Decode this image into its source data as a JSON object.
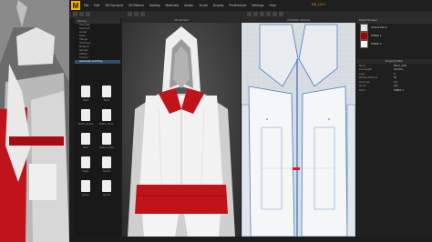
{
  "app": {
    "logo_letter": "M",
    "title": "MD_2013"
  },
  "menu": [
    "File",
    "Edit",
    "3D Garment",
    "2D Pattern",
    "Sewing",
    "Materials",
    "Avatar",
    "Script",
    "Display",
    "Preferences",
    "Settings",
    "Help"
  ],
  "library": {
    "header": "Library",
    "tree": [
      "Favorites",
      "Garment",
      "Avatar",
      "Fabric",
      "Hanger",
      "Hardware",
      "Material",
      "Sample",
      "Pattern",
      "Tutorial",
      "Garments and Rose"
    ],
    "selected_index": 10,
    "items": [
      {
        "caption": "Tshirt"
      },
      {
        "caption": "Pants"
      },
      {
        "caption": "Button_B_Rou"
      },
      {
        "caption": "Button_B_Sh"
      },
      {
        "caption": "Shirt"
      },
      {
        "caption": "Button_Folde"
      },
      {
        "caption": "Cargo"
      },
      {
        "caption": "Hoodie"
      },
      {
        "caption": "Jacket"
      },
      {
        "caption": "Sports"
      }
    ]
  },
  "panes": {
    "view3d_title": "3D Garment",
    "view2d_title": "2D Pattern Window"
  },
  "object_browser": {
    "header": "Object Browser",
    "fabrics": [
      {
        "name": "Default Fabric",
        "color": "#e6e6e6"
      },
      {
        "name": "FABRIC 1",
        "color": "#b00000"
      },
      {
        "name": "FABRIC 2",
        "color": "#f2f2f2"
      }
    ]
  },
  "property_editor": {
    "title": "Property Editor",
    "rows": [
      {
        "key": "Name",
        "value": "Fabric_1201"
      },
      {
        "key": "Line Length",
        "value": "32.49cm"
      },
      {
        "key": "Layer",
        "value": "0"
      },
      {
        "key": "Particle Distance",
        "value": "20"
      },
      {
        "key": "Thickness",
        "value": "1.0"
      },
      {
        "key": "Shrink",
        "value": "100"
      },
      {
        "key": "Fabric",
        "value": "FABRIC 2"
      }
    ]
  },
  "colors": {
    "accent": "#e08a2a",
    "selection": "#304b70",
    "red": "#b00000"
  }
}
